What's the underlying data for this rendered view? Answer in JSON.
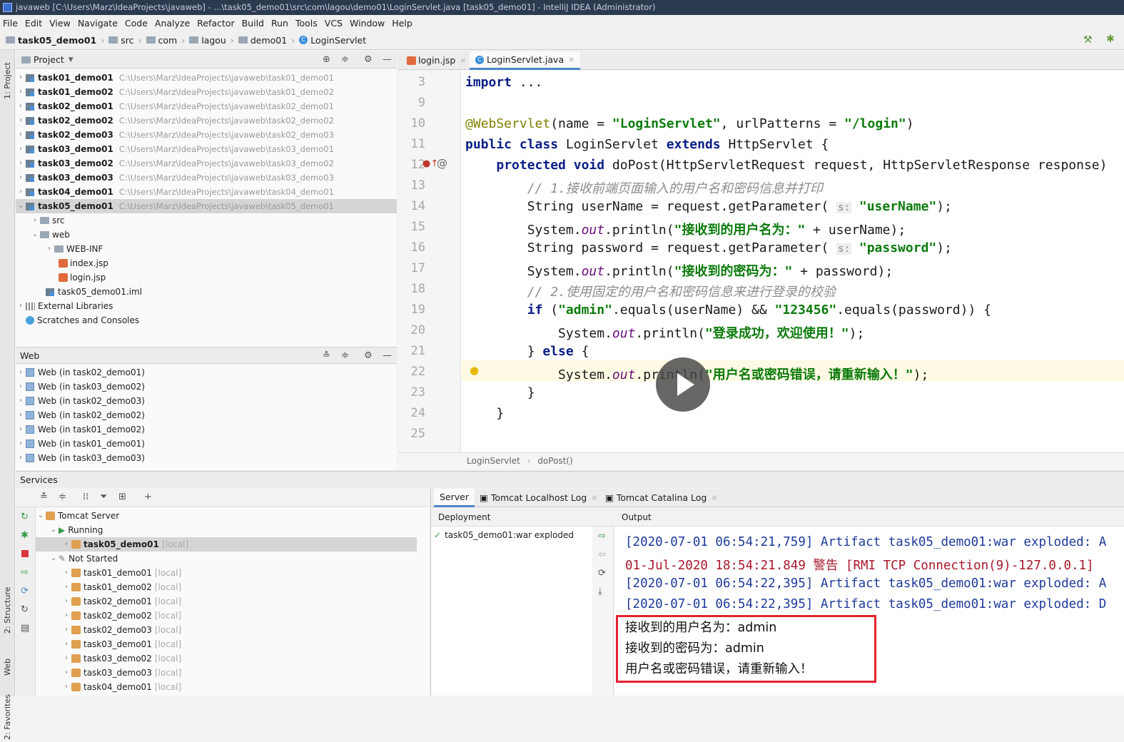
{
  "window": {
    "title": "javaweb [C:\\Users\\Marz\\IdeaProjects\\javaweb] - ...\\task05_demo01\\src\\com\\lagou\\demo01\\LoginServlet.java [task05_demo01] - IntelliJ IDEA (Administrator)"
  },
  "menu": [
    "File",
    "Edit",
    "View",
    "Navigate",
    "Code",
    "Analyze",
    "Refactor",
    "Build",
    "Run",
    "Tools",
    "VCS",
    "Window",
    "Help"
  ],
  "breadcrumb": [
    "task05_demo01",
    "src",
    "com",
    "lagou",
    "demo01",
    "LoginServlet"
  ],
  "side_tabs": {
    "project": "1: Project",
    "structure": "2: Structure",
    "web": "Web",
    "favorites": "2: Favorites"
  },
  "project_panel": {
    "title": "Project",
    "modules": [
      {
        "name": "task01_demo01",
        "path": "C:\\Users\\Marz\\IdeaProjects\\javaweb\\task01_demo01"
      },
      {
        "name": "task01_demo02",
        "path": "C:\\Users\\Marz\\IdeaProjects\\javaweb\\task01_demo02"
      },
      {
        "name": "task02_demo01",
        "path": "C:\\Users\\Marz\\IdeaProjects\\javaweb\\task02_demo01"
      },
      {
        "name": "task02_demo02",
        "path": "C:\\Users\\Marz\\IdeaProjects\\javaweb\\task02_demo02"
      },
      {
        "name": "task02_demo03",
        "path": "C:\\Users\\Marz\\IdeaProjects\\javaweb\\task02_demo03"
      },
      {
        "name": "task03_demo01",
        "path": "C:\\Users\\Marz\\IdeaProjects\\javaweb\\task03_demo01"
      },
      {
        "name": "task03_demo02",
        "path": "C:\\Users\\Marz\\IdeaProjects\\javaweb\\task03_demo02"
      },
      {
        "name": "task03_demo03",
        "path": "C:\\Users\\Marz\\IdeaProjects\\javaweb\\task03_demo03"
      },
      {
        "name": "task04_demo01",
        "path": "C:\\Users\\Marz\\IdeaProjects\\javaweb\\task04_demo01"
      },
      {
        "name": "task05_demo01",
        "path": "C:\\Users\\Marz\\IdeaProjects\\javaweb\\task05_demo01"
      }
    ],
    "children": {
      "src": "src",
      "web": "web",
      "webinf": "WEB-INF",
      "index": "index.jsp",
      "login": "login.jsp",
      "iml": "task05_demo01.iml"
    },
    "external": "External Libraries",
    "scratches": "Scratches and Consoles"
  },
  "web_panel": {
    "title": "Web",
    "items": [
      "Web (in task02_demo01)",
      "Web (in task03_demo02)",
      "Web (in task02_demo03)",
      "Web (in task02_demo02)",
      "Web (in task01_demo02)",
      "Web (in task01_demo01)",
      "Web (in task03_demo03)"
    ]
  },
  "editor": {
    "tabs": [
      "login.jsp",
      "LoginServlet.java"
    ],
    "line_numbers": [
      "3",
      "9",
      "10",
      "11",
      "12",
      "13",
      "14",
      "15",
      "16",
      "17",
      "18",
      "19",
      "20",
      "21",
      "22",
      "23",
      "24",
      "25"
    ],
    "breadcrumb": [
      "LoginServlet",
      "doPost()"
    ]
  },
  "services": {
    "title": "Services",
    "tomcat": "Tomcat Server",
    "running": "Running",
    "running_item": "task05_demo01",
    "not_started": "Not Started",
    "local": "[local]",
    "stopped": [
      "task01_demo01",
      "task01_demo02",
      "task02_demo01",
      "task02_demo02",
      "task02_demo03",
      "task03_demo01",
      "task03_demo02",
      "task03_demo03",
      "task04_demo01"
    ]
  },
  "deploy": {
    "tabs": [
      "Server",
      "Tomcat Localhost Log",
      "Tomcat Catalina Log"
    ],
    "deployment_header": "Deployment",
    "output_header": "Output",
    "artifact": "task05_demo01:war exploded"
  },
  "output_lines": [
    "[2020-07-01 06:54:21,759] Artifact task05_demo01:war exploded: A",
    "01-Jul-2020 18:54:21.849 警告 [RMI TCP Connection(9)-127.0.0.1]",
    "[2020-07-01 06:54:22,395] Artifact task05_demo01:war exploded: A",
    "[2020-07-01 06:54:22,395] Artifact task05_demo01:war exploded: D",
    "接收到的用户名为：admin",
    "接收到的密码为：admin",
    "用户名或密码错误，请重新输入！"
  ],
  "colors": {
    "accent": "#4a88c7",
    "highlight_box": "#e3232f",
    "keyword": "#0a1e87",
    "string": "#0b7a0b"
  }
}
